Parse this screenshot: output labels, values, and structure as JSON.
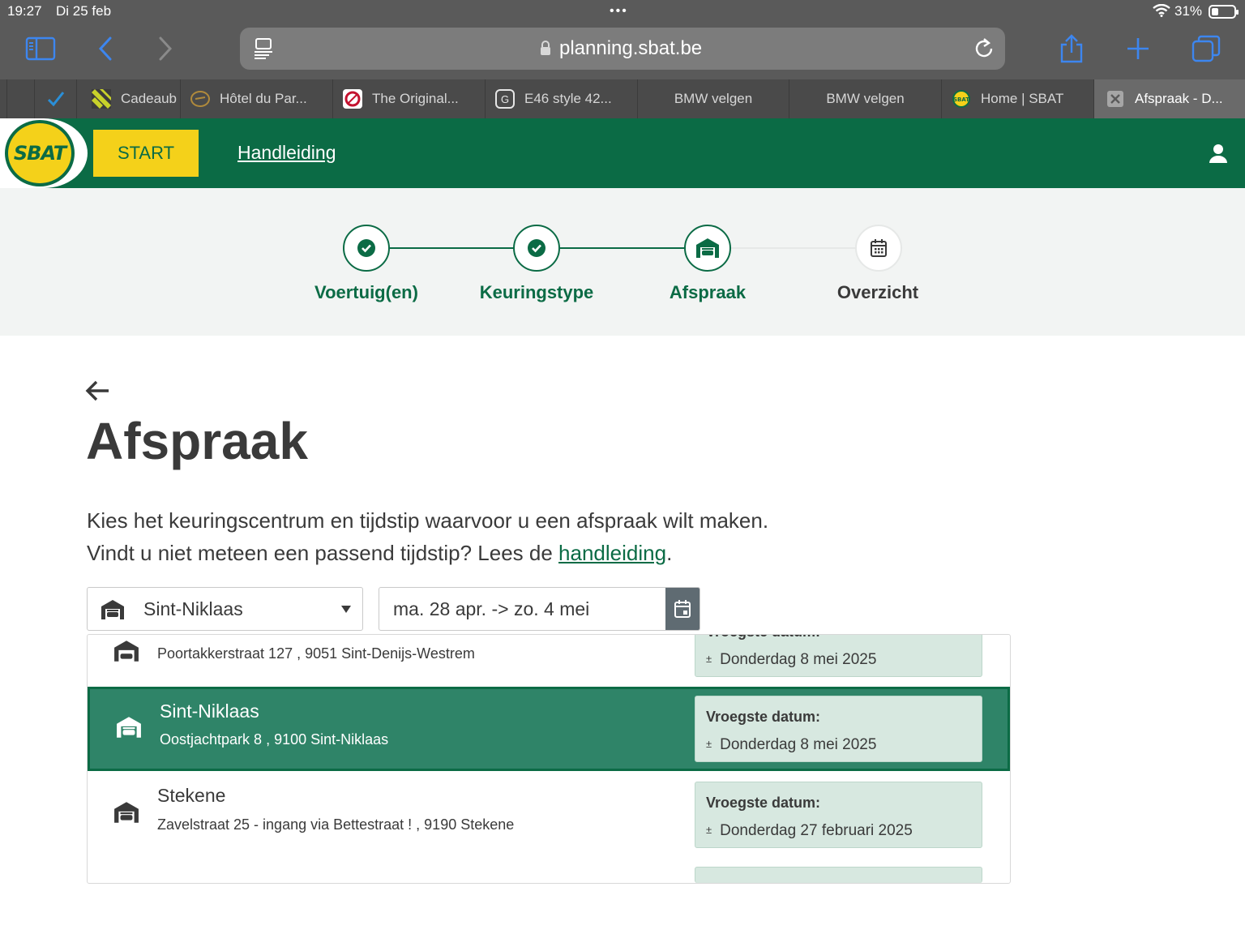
{
  "status": {
    "time": "19:27",
    "date": "Di 25 feb",
    "battery": "31%",
    "battery_level": 0.31,
    "dots": "•••"
  },
  "browser": {
    "url": "planning.sbat.be",
    "tabs": [
      {
        "title": "",
        "icon": "check-icon"
      },
      {
        "title": "Cadeaub",
        "icon": "stripes-icon"
      },
      {
        "title": "Hôtel du Par...",
        "icon": "hotel-icon"
      },
      {
        "title": "The Original...",
        "icon": "original-icon"
      },
      {
        "title": "E46 style 42...",
        "icon": "g-icon"
      },
      {
        "title": "BMW velgen",
        "icon": ""
      },
      {
        "title": "BMW velgen",
        "icon": ""
      },
      {
        "title": "Home | SBAT",
        "icon": "sbat-icon"
      },
      {
        "title": "Afspraak - D...",
        "icon": "close-tab-icon",
        "active": true
      }
    ]
  },
  "header": {
    "logo_text": "SBAT",
    "start_label": "START",
    "manual_link": "Handleiding"
  },
  "stepper": {
    "steps": [
      {
        "label": "Voertuig(en)",
        "state": "done"
      },
      {
        "label": "Keuringstype",
        "state": "done"
      },
      {
        "label": "Afspraak",
        "state": "current"
      },
      {
        "label": "Overzicht",
        "state": "pending"
      }
    ]
  },
  "main": {
    "title": "Afspraak",
    "intro_line1": "Kies het keuringscentrum en tijdstip waarvoor u een afspraak wilt maken.",
    "intro_line2_prefix": "Vindt u niet meteen een passend tijdstip? Lees de ",
    "intro_link": "handleiding",
    "intro_suffix": ".",
    "center_select": "Sint-Niklaas",
    "date_range": "ma. 28 apr. -> zo. 4 mei"
  },
  "dropdown": {
    "earliest_label": "Vroegste datum:",
    "approx_symbol": "±",
    "items": [
      {
        "name": "",
        "address": "Poortakkerstraat 127 , 9051 Sint-Denijs-Westrem",
        "date": "Donderdag 8 mei 2025"
      },
      {
        "name": "Sint-Niklaas",
        "address": "Oostjachtpark 8 , 9100 Sint-Niklaas",
        "date": "Donderdag 8 mei 2025",
        "selected": true
      },
      {
        "name": "Stekene",
        "address": "Zavelstraat 25 - ingang via Bettestraat ! , 9190 Stekene",
        "date": "Donderdag 27 februari 2025"
      }
    ]
  },
  "colors": {
    "brand_green": "#0b6b45",
    "brand_yellow": "#f4d11a",
    "selected_row": "#2f8468",
    "card_bg": "#d7e8e0"
  }
}
